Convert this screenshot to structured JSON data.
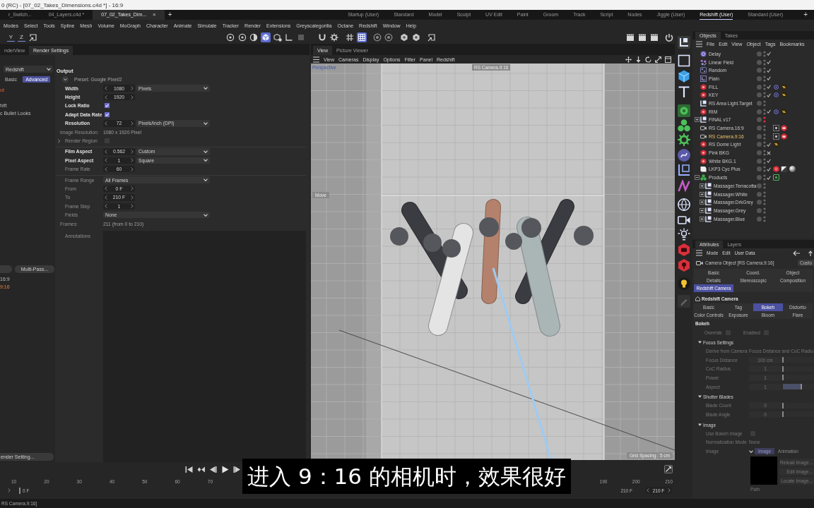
{
  "window": {
    "title": "0 (RC) - [07_02_Takes_Dimensions.c4d *] - 16:9"
  },
  "document_tabs": [
    {
      "label": "r_Switch...",
      "selected": false
    },
    {
      "label": "04_Layers.c4d *",
      "selected": false
    },
    {
      "label": "07_02_Takes_Dim...",
      "selected": true,
      "close": "×"
    }
  ],
  "new_tab": "+",
  "layouts": [
    {
      "label": "Startup (User)",
      "selected": false
    },
    {
      "label": "Standard",
      "selected": false
    },
    {
      "label": "Model",
      "selected": false
    },
    {
      "label": "Sculpt",
      "selected": false
    },
    {
      "label": "UV Edit",
      "selected": false
    },
    {
      "label": "Paint",
      "selected": false
    },
    {
      "label": "Groom",
      "selected": false
    },
    {
      "label": "Track",
      "selected": false
    },
    {
      "label": "Script",
      "selected": false
    },
    {
      "label": "Nodes",
      "selected": false
    },
    {
      "label": "Jiggle (User)",
      "selected": false
    },
    {
      "label": "Redshift (User)",
      "selected": true
    },
    {
      "label": "Standard (User)",
      "selected": false
    }
  ],
  "new_layout": "+",
  "menu": [
    "Modes",
    "Select",
    "Tools",
    "Spline",
    "Mesh",
    "Volume",
    "MoGraph",
    "Character",
    "Animate",
    "Simulate",
    "Tracker",
    "Render",
    "Extensions",
    "Greyscalegorilla",
    "Octane",
    "Redshift",
    "Window",
    "Help"
  ],
  "toolbar": {
    "axes": [
      {
        "label": "Y",
        "selected": true
      },
      {
        "label": "Z",
        "selected": true
      }
    ],
    "left_tools": [
      {
        "kind": "frame",
        "selected": false
      }
    ],
    "groups": [
      [
        {
          "kind": "sphere",
          "selected": false
        },
        {
          "kind": "sphere",
          "selected": false
        },
        {
          "kind": "half_sphere",
          "selected": false
        },
        {
          "kind": "cube",
          "selected": true
        },
        {
          "kind": "cube_gear",
          "selected": false
        },
        {
          "kind": "axis",
          "selected": false
        },
        {
          "kind": "square",
          "selected": false
        }
      ],
      [
        {
          "kind": "magnet",
          "selected": false
        },
        {
          "kind": "gear",
          "selected": false
        }
      ],
      [
        {
          "kind": "hash",
          "selected": false
        },
        {
          "kind": "grid",
          "selected": true
        }
      ],
      [
        {
          "kind": "target",
          "selected": false
        },
        {
          "kind": "target",
          "selected": false
        }
      ],
      [
        {
          "kind": "hexagon",
          "selected": false
        },
        {
          "kind": "hexagon",
          "selected": false
        }
      ],
      [
        {
          "kind": "frame",
          "selected": false
        }
      ]
    ],
    "right_tools": [
      {
        "kind": "clapper",
        "selected": false
      },
      {
        "kind": "clapper",
        "selected": false
      },
      {
        "kind": "clapper",
        "selected": false
      },
      {
        "kind": "ring",
        "selected": false
      }
    ]
  },
  "render_panel": {
    "tabs": [
      {
        "label": "nderView",
        "selected": false
      },
      {
        "label": "Render Settings",
        "selected": true
      }
    ],
    "renderer": "Redshift",
    "modes": [
      {
        "label": "Basic",
        "selected": false
      },
      {
        "label": "Advanced",
        "selected": true
      }
    ],
    "sections": [
      {
        "label": "ut",
        "selected": true
      },
      {
        "label": "hift",
        "selected": false
      },
      {
        "label": "c Bullet Looks",
        "selected": false
      }
    ],
    "multipass_button": "Multi-Pass...",
    "takes": [
      {
        "label": "16:9",
        "selected": false
      },
      {
        "label": "9:16",
        "selected": true
      }
    ],
    "footer_button": "ender Setting...",
    "output": {
      "heading": "Output",
      "preset": "Preset: Google Pixel/2",
      "groups": [
        [
          {
            "kind": "number",
            "label": "Width",
            "modified": true,
            "value": "1080",
            "option": "Pixels"
          },
          {
            "kind": "number",
            "label": "Height",
            "modified": true,
            "value": "1920"
          },
          {
            "kind": "checkbox",
            "label": "Lock Ratio",
            "modified": true,
            "checked": true
          },
          {
            "kind": "checkbox",
            "label": "Adapt Data Rate",
            "modified": true,
            "checked": true
          },
          {
            "kind": "number",
            "label": "Resolution",
            "modified": true,
            "value": "72",
            "option": "Pixels/Inch (DPI)"
          },
          {
            "kind": "info",
            "label": "Image Resolution:",
            "value": "1080 x 1920 Pixel"
          },
          {
            "kind": "checkbox",
            "label": "Render Region",
            "modified": false,
            "checked": false,
            "expanded": false
          }
        ],
        [
          {
            "kind": "number",
            "label": "Film Aspect",
            "modified": true,
            "value": "0.562",
            "option": "Custom"
          },
          {
            "kind": "number",
            "label": "Pixel Aspect",
            "modified": true,
            "value": "1",
            "option": "Square"
          },
          {
            "kind": "number",
            "label": "Frame Rate",
            "modified": false,
            "value": "60"
          }
        ],
        [
          {
            "kind": "dropdown",
            "label": "Frame Range",
            "modified": false,
            "option": "All Frames"
          },
          {
            "kind": "number",
            "label": "From",
            "modified": false,
            "value": "0 F"
          },
          {
            "kind": "number",
            "label": "To",
            "modified": false,
            "value": "210 F"
          },
          {
            "kind": "number",
            "label": "Frame Step",
            "modified": false,
            "value": "1"
          },
          {
            "kind": "dropdown",
            "label": "Fields",
            "modified": false,
            "option": "None"
          },
          {
            "kind": "info",
            "label": "Frames:",
            "value": "211 (from 0 to 210)"
          }
        ]
      ],
      "annotations": "Annotations"
    }
  },
  "viewport": {
    "tabs": [
      {
        "label": "View",
        "selected": true
      },
      {
        "label": "Picture Viewer",
        "selected": false
      }
    ],
    "menu": [
      "View",
      "Cameras",
      "Display",
      "Options",
      "Filter",
      "Panel",
      "Redshift"
    ],
    "projection": "Perspective",
    "camera": "RS Camera.9:16",
    "tool_hud": "Move",
    "grid_spacing": "Grid Spacing : 5 cm"
  },
  "timeline": {
    "ruler_start": [
      "10",
      "20",
      "30",
      "40",
      "50",
      "60",
      "70"
    ],
    "ruler_end": [
      "190",
      "200",
      "210"
    ],
    "current_frame": "0 F",
    "end_frame": "210 F",
    "max_frame": "210 F"
  },
  "subtitle": "进入 9：16 的相机时，效果很好",
  "objects_panel": {
    "tabs": [
      {
        "label": "Objects",
        "selected": true
      },
      {
        "label": "Takes",
        "selected": false
      }
    ],
    "menu": [
      "File",
      "Edit",
      "View",
      "Object",
      "Tags",
      "Bookmarks"
    ],
    "tree": [
      {
        "name": "Delay",
        "kind": "effector",
        "selected": false,
        "hidden": false,
        "enabled": true
      },
      {
        "name": "Linear Field",
        "kind": "field",
        "selected": false,
        "hidden": false,
        "enabled": true
      },
      {
        "name": "Random",
        "kind": "random",
        "selected": false,
        "hidden": false,
        "enabled": true
      },
      {
        "name": "Plain",
        "kind": "plain",
        "selected": false,
        "hidden": false,
        "enabled": true
      },
      {
        "name": "FILL",
        "kind": "rs_light",
        "selected": false,
        "hidden": false,
        "enabled": true,
        "tags": [
          {
            "kind": "target"
          },
          {
            "kind": "light_link"
          }
        ]
      },
      {
        "name": "KEY",
        "kind": "rs_light",
        "selected": false,
        "hidden": false,
        "enabled": true,
        "tags": [
          {
            "kind": "target"
          },
          {
            "kind": "light_link"
          }
        ]
      },
      {
        "name": "RS Area Light.Target",
        "kind": "null",
        "selected": false,
        "hidden": false
      },
      {
        "name": "RIM",
        "kind": "rs_light",
        "selected": false,
        "hidden": false,
        "enabled": true,
        "tags": [
          {
            "kind": "target"
          },
          {
            "kind": "light_link"
          }
        ]
      },
      {
        "name": "FINAL v17",
        "kind": "null",
        "selected": false,
        "hidden": true,
        "expanded": false
      },
      {
        "name": "RS Camera.16:9",
        "kind": "camera",
        "selected": false,
        "hidden": false,
        "tags": [
          {
            "kind": "protection"
          },
          {
            "kind": "rs_camera"
          }
        ]
      },
      {
        "name": "RS Camera.9:16",
        "kind": "camera",
        "selected": true,
        "hidden": false,
        "tags": [
          {
            "kind": "protection"
          },
          {
            "kind": "rs_camera"
          }
        ]
      },
      {
        "name": "RS Dome Light",
        "kind": "rs_light",
        "selected": false,
        "hidden": false,
        "enabled": true,
        "tags": [
          {
            "kind": "light_link"
          }
        ]
      },
      {
        "name": "Pink BKG",
        "kind": "rs_light",
        "selected": false,
        "hidden": false,
        "enabled": false
      },
      {
        "name": "White BKG.1",
        "kind": "rs_light",
        "selected": false,
        "hidden": false,
        "enabled": true
      },
      {
        "name": "LKP3 Cyc Plus",
        "kind": "cyc",
        "selected": false,
        "hidden": false,
        "enabled": true,
        "tags": [
          {
            "kind": "rs_object"
          },
          {
            "kind": "texture"
          },
          {
            "kind": "material"
          }
        ]
      },
      {
        "name": "Products",
        "kind": "mograph",
        "selected": false,
        "hidden": false,
        "enabled": true,
        "expanded": true,
        "tags": [
          {
            "kind": "selection"
          }
        ],
        "children": [
          {
            "name": "Massager.Terracotta",
            "kind": "null",
            "selected": false,
            "hidden": false,
            "expanded": false
          },
          {
            "name": "Massager.White",
            "kind": "null",
            "selected": false,
            "hidden": false,
            "expanded": false
          },
          {
            "name": "Massager.DrkGrey",
            "kind": "null",
            "selected": false,
            "hidden": false,
            "expanded": false
          },
          {
            "name": "Massager.Grey",
            "kind": "null",
            "selected": false,
            "hidden": false,
            "expanded": false
          },
          {
            "name": "Massager.Blue",
            "kind": "null",
            "selected": false,
            "hidden": false,
            "expanded": false
          }
        ]
      }
    ]
  },
  "attributes_panel": {
    "tabs": [
      {
        "label": "Attributes",
        "selected": true
      },
      {
        "label": "Layers",
        "selected": false
      }
    ],
    "menu": [
      "Mode",
      "Edit",
      "User Data"
    ],
    "object": "Camera Object [RS Camera.9:16]",
    "preset_button": "Custo",
    "object_tabs": [
      {
        "label": "Basic",
        "selected": false
      },
      {
        "label": "Coord.",
        "selected": false
      },
      {
        "label": "Object",
        "selected": false
      },
      {
        "label": "Details",
        "selected": false
      },
      {
        "label": "Stereoscopic",
        "selected": false
      },
      {
        "label": "Composition",
        "selected": false
      },
      {
        "label": "Redshift Camera",
        "selected": true
      }
    ],
    "section": "Redshift Camera",
    "section_tabs": [
      {
        "label": "Basic",
        "selected": false
      },
      {
        "label": "Tag",
        "selected": false
      },
      {
        "label": "Bokeh",
        "selected": true
      },
      {
        "label": "Distortio",
        "selected": false
      },
      {
        "label": "Color Controls",
        "selected": false
      },
      {
        "label": "Exposure",
        "selected": false
      },
      {
        "label": "Bloom",
        "selected": false
      },
      {
        "label": "Flare",
        "selected": false
      }
    ],
    "bokeh": {
      "heading": "Bokeh",
      "disabled": true,
      "toggles": [
        {
          "label": "Override",
          "checked": false
        },
        {
          "label": "Enabled",
          "checked": false
        }
      ],
      "groups": [
        {
          "title": "Focus Settings",
          "expanded": true,
          "params": [
            {
              "kind": "text",
              "label": "Derive from Camera",
              "value": "Focus Distance and CoC Radiu"
            },
            {
              "kind": "slider",
              "label": "Focus Distance",
              "value": "100 cm",
              "level": 0
            },
            {
              "kind": "slider",
              "label": "CoC Radius",
              "value": "1",
              "level": 0
            },
            {
              "kind": "slider",
              "label": "Power",
              "value": "1",
              "level": 0
            },
            {
              "kind": "slider",
              "label": "Aspect",
              "value": "1",
              "level": 0.6
            }
          ]
        },
        {
          "title": "Shutter Blades",
          "expanded": true,
          "params": [
            {
              "kind": "slider",
              "label": "Blade Count",
              "value": "0",
              "level": 0
            },
            {
              "kind": "slider",
              "label": "Blade Angle",
              "value": "0",
              "level": 0
            }
          ]
        },
        {
          "title": "Image",
          "expanded": true,
          "params": [
            {
              "kind": "checkbox",
              "label": "Use Bokeh Image",
              "checked": false
            },
            {
              "kind": "text",
              "label": "Normalization Mode",
              "value": "None"
            },
            {
              "kind": "image",
              "label": "Image",
              "tabs": [
                {
                  "label": "Image",
                  "selected": true
                },
                {
                  "label": "Animation",
                  "selected": false
                }
              ],
              "buttons": [
                "Reload Image...",
                "Edit Image...",
                "Locate Image..."
              ]
            },
            {
              "kind": "label",
              "label": "Path"
            }
          ]
        }
      ]
    }
  },
  "status_bar": {
    "text": "RS Camera.9:16]"
  }
}
